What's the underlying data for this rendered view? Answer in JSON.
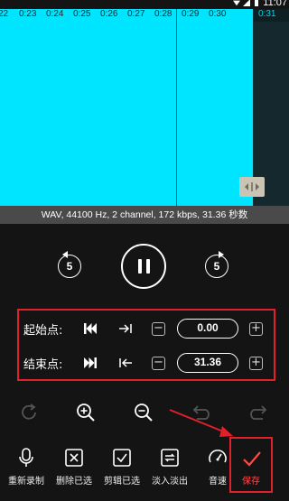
{
  "status_bar": {
    "time": "11:07"
  },
  "timeline": {
    "ticks": [
      "22",
      "0:23",
      "0:24",
      "0:25",
      "0:26",
      "0:27",
      "0:28",
      "0:29",
      "0:30",
      "0:31"
    ]
  },
  "file_info": "WAV, 44100 Hz, 2 channel, 172 kbps, 31.36 秒数",
  "playback": {
    "skip_back": "5",
    "skip_forward": "5",
    "state": "playing"
  },
  "trim": {
    "start": {
      "label": "起始点:",
      "value": "0.00"
    },
    "end": {
      "label": "结束点:",
      "value": "31.36"
    },
    "minus": "−",
    "plus": "+"
  },
  "toolbar": {
    "items": [
      {
        "label": "重新录制",
        "icon": "microphone-icon"
      },
      {
        "label": "删除已选",
        "icon": "delete-selection-icon"
      },
      {
        "label": "剪辑已选",
        "icon": "clip-selection-icon"
      },
      {
        "label": "淡入淡出",
        "icon": "fade-icon"
      },
      {
        "label": "音速",
        "icon": "speed-gauge-icon"
      }
    ],
    "save": {
      "label": "保存",
      "icon": "checkmark-icon"
    }
  },
  "colors": {
    "waveform": "#00e5ff",
    "highlight": "#e0202a",
    "save_text": "#ff4a4a"
  }
}
